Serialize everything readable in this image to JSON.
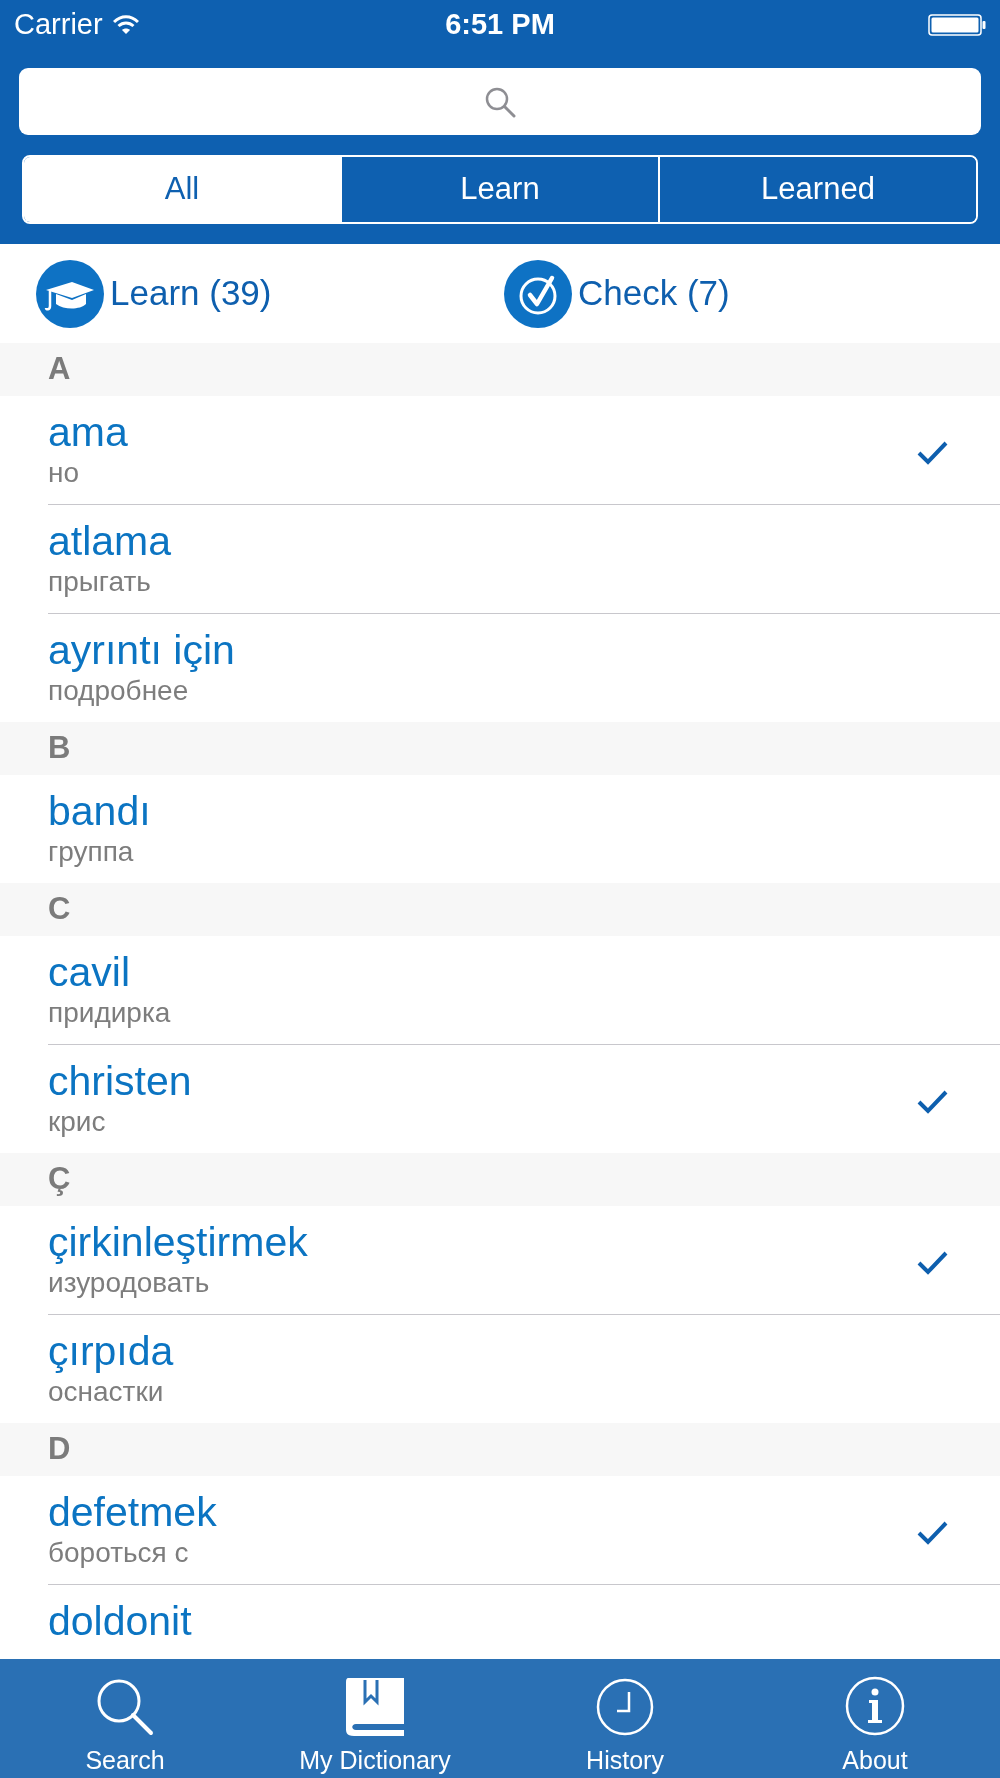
{
  "status_bar": {
    "carrier": "Carrier",
    "time": "6:51 PM"
  },
  "filter_tabs": [
    {
      "label": "All",
      "selected": true
    },
    {
      "label": "Learn",
      "selected": false
    },
    {
      "label": "Learned",
      "selected": false
    }
  ],
  "actions": [
    {
      "kind": "learn",
      "label": "Learn (39)"
    },
    {
      "kind": "check",
      "label": "Check (7)"
    }
  ],
  "sections": [
    {
      "letter": "A",
      "entries": [
        {
          "word": "ama",
          "translation": "но",
          "checked": true
        },
        {
          "word": "atlama",
          "translation": "прыгать",
          "checked": false
        },
        {
          "word": "ayrıntı için",
          "translation": "подробнее",
          "checked": false
        }
      ]
    },
    {
      "letter": "B",
      "entries": [
        {
          "word": "bandı",
          "translation": "группа",
          "checked": false
        }
      ]
    },
    {
      "letter": "C",
      "entries": [
        {
          "word": "cavil",
          "translation": "придирка",
          "checked": false
        },
        {
          "word": "christen",
          "translation": "крис",
          "checked": true
        }
      ]
    },
    {
      "letter": "Ç",
      "entries": [
        {
          "word": "çirkinleştirmek",
          "translation": "изуродовать",
          "checked": true
        },
        {
          "word": "çırpıda",
          "translation": "оснастки",
          "checked": false
        }
      ]
    },
    {
      "letter": "D",
      "entries": [
        {
          "word": "defetmek",
          "translation": "бороться с",
          "checked": true
        },
        {
          "word": "doldonit",
          "checked": false
        }
      ]
    }
  ],
  "tab_bar": [
    {
      "kind": "search",
      "label": "Search"
    },
    {
      "kind": "dictionary",
      "label": "My Dictionary"
    },
    {
      "kind": "history",
      "label": "History"
    },
    {
      "kind": "about",
      "label": "About"
    }
  ]
}
